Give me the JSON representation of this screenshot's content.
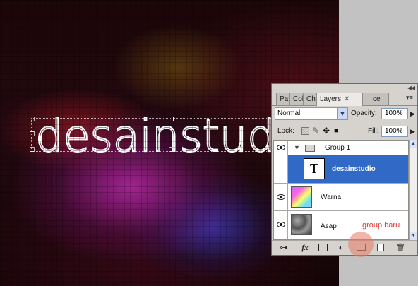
{
  "canvas": {
    "headline": "desainstudio"
  },
  "panel": {
    "tabs": [
      {
        "label": "Pat",
        "active": false
      },
      {
        "label": "Col",
        "active": false
      },
      {
        "label": "Ch",
        "active": false
      },
      {
        "label": "Layers",
        "active": true
      },
      {
        "label": "ce",
        "active": false
      }
    ],
    "close_glyph": "✕",
    "blend_mode": "Normal",
    "opacity_label": "Opacity:",
    "opacity_value": "100%",
    "lock_label": "Lock:",
    "fill_label": "Fill:",
    "fill_value": "100%",
    "layers": [
      {
        "name": "Group 1",
        "type": "group",
        "visible": true,
        "selected": false
      },
      {
        "name": "desainstudio",
        "type": "text",
        "visible": false,
        "selected": true,
        "thumb_glyph": "T"
      },
      {
        "name": "Warna",
        "type": "image",
        "visible": true,
        "selected": false
      },
      {
        "name": "Asap",
        "type": "image",
        "visible": true,
        "selected": false
      }
    ],
    "bottom_icons": [
      "link-icon",
      "fx-icon",
      "mask-icon",
      "adjustment-icon",
      "new-group-icon",
      "new-layer-icon",
      "trash-icon"
    ],
    "fx_label": "fx"
  },
  "annotation": {
    "text": "group baru",
    "color": "#e23a3a"
  },
  "colors": {
    "selected_row": "#3169c6",
    "canvas_magenta": "#b928aa",
    "canvas_blue": "#3c3cc8"
  }
}
